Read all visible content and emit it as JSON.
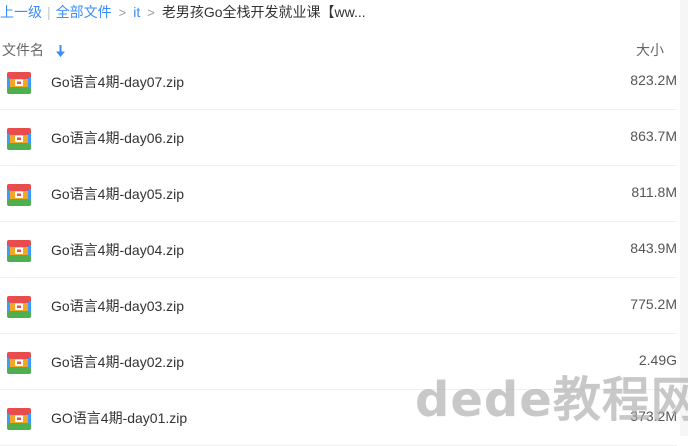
{
  "breadcrumb": {
    "back": "上一级",
    "separator": "|",
    "all_files": "全部文件",
    "arrow": ">",
    "folder": "it",
    "current": "老男孩Go全栈开发就业课【ww..."
  },
  "header": {
    "name_col": "文件名",
    "size_col": "大小"
  },
  "files": [
    {
      "name": "Go语言4期-day07.zip",
      "size": "823.2M"
    },
    {
      "name": "Go语言4期-day06.zip",
      "size": "863.7M"
    },
    {
      "name": "Go语言4期-day05.zip",
      "size": "811.8M"
    },
    {
      "name": "Go语言4期-day04.zip",
      "size": "843.9M"
    },
    {
      "name": "Go语言4期-day03.zip",
      "size": "775.2M"
    },
    {
      "name": "Go语言4期-day02.zip",
      "size": "2.49G"
    },
    {
      "name": "GO语言4期-day01.zip",
      "size": "373.2M"
    }
  ],
  "watermark": "dede教程网",
  "icons": {
    "file_type": "zip-archive-icon",
    "sort": "sort-down-arrow-icon"
  },
  "colors": {
    "link": "#3b8cff",
    "zip_top": "#e84c4c",
    "zip_middle": "#f5a623",
    "zip_bottom": "#4caf50",
    "zip_side": "#3b9cff"
  }
}
